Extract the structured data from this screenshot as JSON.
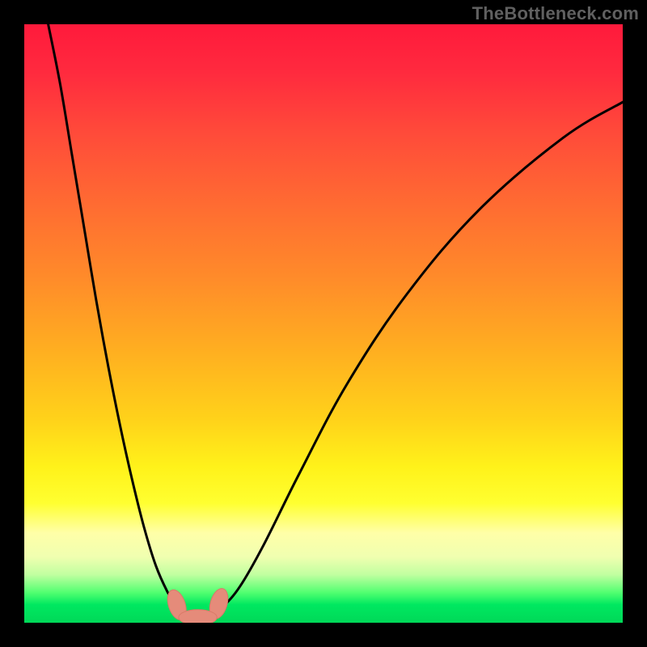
{
  "watermark": "TheBottleneck.com",
  "chart_data": {
    "type": "line",
    "title": "",
    "xlabel": "",
    "ylabel": "",
    "xlim": [
      0,
      100
    ],
    "ylim": [
      0,
      100
    ],
    "grid": false,
    "legend": false,
    "series": [
      {
        "name": "bottleneck-curve-left",
        "x": [
          4,
          6,
          8,
          10,
          12,
          14,
          16,
          18,
          20,
          22,
          24,
          25.5,
          26.5,
          27.5
        ],
        "y": [
          100,
          90,
          78,
          66,
          54,
          43,
          33,
          24,
          16,
          9.5,
          5,
          2.5,
          1.5,
          1.0
        ]
      },
      {
        "name": "bottleneck-curve-right",
        "x": [
          31,
          33,
          36,
          40,
          46,
          54,
          64,
          76,
          90,
          100
        ],
        "y": [
          1.0,
          2.5,
          6,
          13,
          25,
          40,
          55,
          69,
          81,
          87
        ]
      },
      {
        "name": "flat-bottom",
        "x": [
          27.5,
          31
        ],
        "y": [
          1.0,
          1.0
        ]
      }
    ],
    "markers": [
      {
        "name": "blob-left",
        "x": 25.5,
        "y": 3.0,
        "rx": 1.4,
        "ry": 2.6,
        "rot": -18
      },
      {
        "name": "blob-right",
        "x": 32.5,
        "y": 3.2,
        "rx": 1.4,
        "ry": 2.6,
        "rot": 16
      },
      {
        "name": "blob-bottom",
        "x": 29.0,
        "y": 0.9,
        "rx": 3.2,
        "ry": 1.3,
        "rot": 0
      }
    ],
    "colors": {
      "curve": "#000000",
      "marker_fill": "#e58b7a",
      "marker_stroke": "#d87a68",
      "gradient_top": "#ff1a3c",
      "gradient_bottom": "#00d858"
    }
  }
}
